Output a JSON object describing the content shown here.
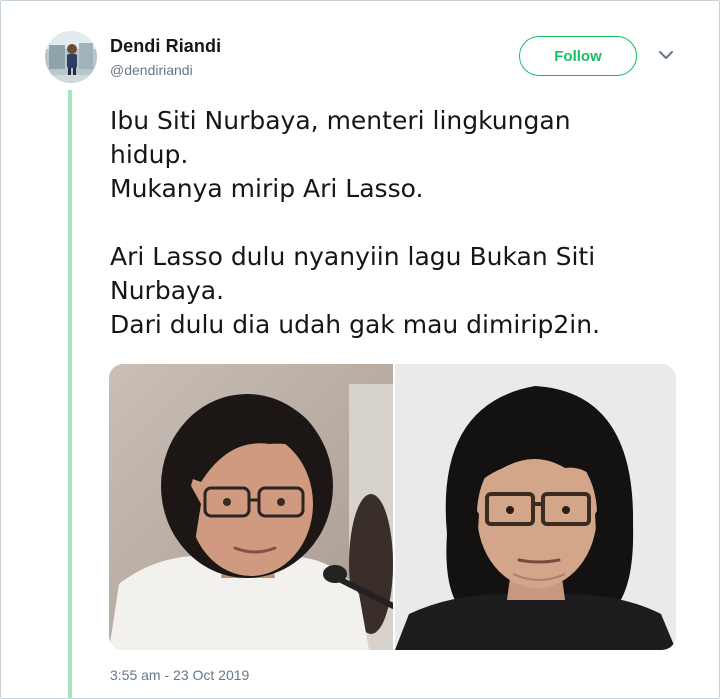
{
  "tweet": {
    "author_name": "Dendi Riandi",
    "author_handle": "@dendiriandi",
    "follow_label": "Follow",
    "text_lines": [
      "Ibu Siti Nurbaya, menteri lingkungan",
      "hidup.",
      "Mukanya mirip Ari Lasso.",
      "",
      "Ari Lasso dulu nyanyiin lagu Bukan Siti",
      "Nurbaya.",
      "Dari dulu dia udah gak mau dimirip2in."
    ],
    "timestamp": "3:55 am - 23 Oct 2019"
  },
  "icons": {
    "more_menu": "chevron-down-icon"
  },
  "colors": {
    "follow_accent": "#17bf63",
    "thread_line": "#a6e3bf",
    "secondary_text": "#657786"
  }
}
